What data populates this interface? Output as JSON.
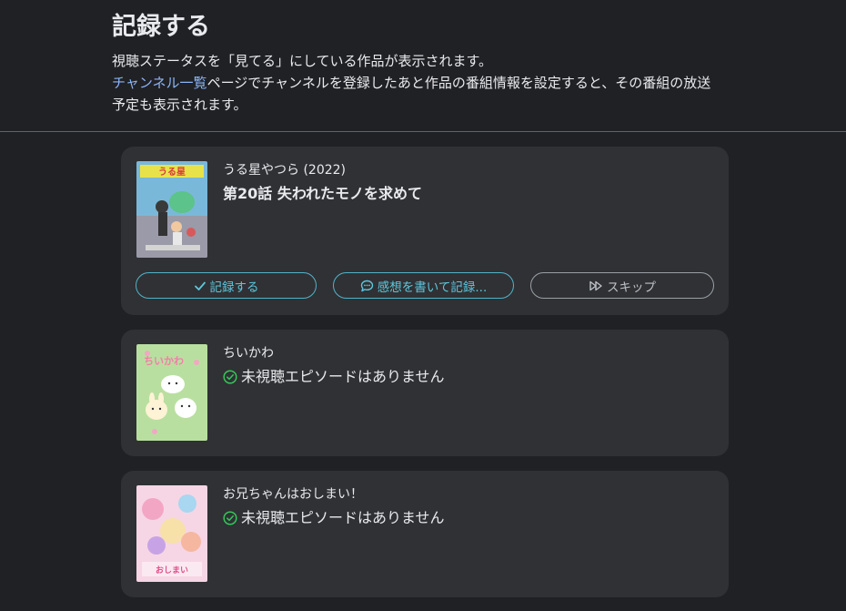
{
  "header": {
    "title": "記録する",
    "description_line1": "視聴ステータスを「見てる」にしている作品が表示されます。",
    "channel_link": "チャンネル一覧",
    "description_line2_rest": "ページでチャンネルを登録したあと作品の番組情報を設定すると、その番組の放送",
    "description_line3": "予定も表示されます。"
  },
  "cards": [
    {
      "work_title": "うる星やつら (2022)",
      "episode_title": "第20話 失われたモノを求めて",
      "buttons": {
        "record": "記録する",
        "comment": "感想を書いて記録...",
        "skip": "スキップ"
      }
    },
    {
      "work_title": "ちいかわ",
      "status": "未視聴エピソードはありません"
    },
    {
      "work_title": "お兄ちゃんはおしまい！",
      "status": "未視聴エピソードはありません"
    }
  ],
  "icons": {
    "record": "check-icon",
    "comment": "chat-bubble-icon",
    "skip": "fast-forward-icon",
    "status": "check-circle-icon"
  },
  "colors": {
    "background": "#202124",
    "card": "#303134",
    "link": "#8ab4f8",
    "accent": "#5ec6dd",
    "success": "#34c759"
  }
}
